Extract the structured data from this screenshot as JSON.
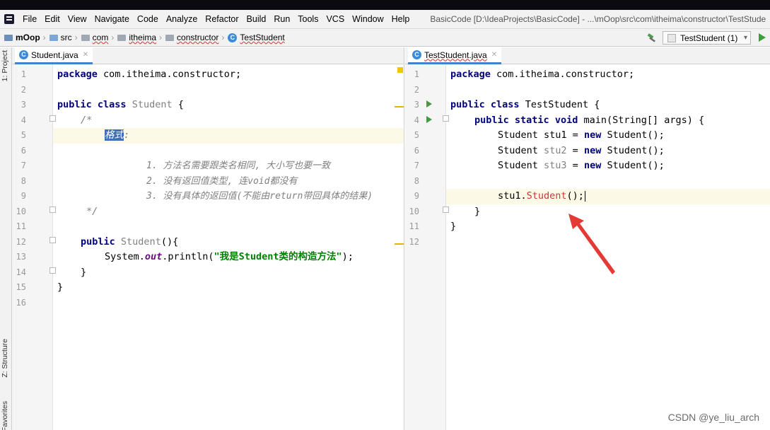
{
  "menubar": {
    "items": [
      "File",
      "Edit",
      "View",
      "Navigate",
      "Code",
      "Analyze",
      "Refactor",
      "Build",
      "Run",
      "Tools",
      "VCS",
      "Window",
      "Help"
    ],
    "title": "BasicCode [D:\\IdeaProjects\\BasicCode] - ...\\mOop\\src\\com\\itheima\\constructor\\TestStude"
  },
  "breadcrumb": {
    "items": [
      "mOop",
      "src",
      "com",
      "itheima",
      "constructor",
      "TestStudent"
    ]
  },
  "toolbar": {
    "run_config": "TestStudent (1)"
  },
  "sidebar": {
    "tabs": [
      "1: Project",
      "Z: Structure",
      "Favorites"
    ]
  },
  "left_editor": {
    "tab": "Student.java",
    "line_numbers": [
      "1",
      "2",
      "3",
      "4",
      "5",
      "6",
      "7",
      "8",
      "9",
      "10",
      "11",
      "12",
      "13",
      "14",
      "15",
      "16"
    ],
    "lines": [
      "package com.itheima.constructor;",
      "",
      "public class Student {",
      "    /*",
      "        格式:",
      "",
      "            1. 方法名需要跟类名相同, 大小写也要一致",
      "            2. 没有返回值类型, 连void都没有",
      "            3. 没有具体的返回值(不能由return带回具体的结果)",
      "     */",
      "",
      "    public Student(){",
      "        System.out.println(\"我是Student类的构造方法\");",
      "    }",
      "}",
      ""
    ],
    "tokens": {
      "package_kw": "package",
      "package_name": " com.itheima.constructor;",
      "public": "public",
      "class": "class",
      "class_name": "Student",
      "brace_open": " {",
      "comment_open": "/*",
      "format_label": "格式",
      "colon": ":",
      "rule1": "1. 方法名需要跟类名相同, 大小写也要一致",
      "rule2": "2. 没有返回值类型, 连void都没有",
      "rule3": "3. 没有具体的返回值(不能由return带回具体的结果)",
      "comment_close": "*/",
      "ctor_name": "Student",
      "ctor_sig": "(){",
      "system": "System.",
      "out": "out",
      "println": ".println(",
      "string": "\"我是Student类的构造方法\"",
      "stmt_end": ");",
      "close_brace": "}"
    }
  },
  "right_editor": {
    "tab": "TestStudent.java",
    "line_numbers": [
      "1",
      "2",
      "3",
      "4",
      "5",
      "6",
      "7",
      "8",
      "9",
      "10",
      "11",
      "12"
    ],
    "tokens": {
      "package_kw": "package",
      "package_name": " com.itheima.constructor;",
      "public": "public",
      "class": "class",
      "class_name": " TestStudent {",
      "static": "static",
      "void": "void",
      "main_sig": " main(String[] args) {",
      "student_type": "Student ",
      "stu1": "stu1",
      "stu2": "stu2",
      "stu3": "stu3",
      "assign": " = ",
      "new": "new",
      "ctor_call": " Student();",
      "stu1_dot": "stu1.",
      "ctor_red": "Student",
      "call_end": "();",
      "close_brace": "}"
    }
  },
  "watermark": "CSDN @ye_liu_arch",
  "colors": {
    "keyword": "#000080",
    "string": "#008000",
    "comment": "#808080",
    "selection": "#3f6fb5",
    "current_line": "#fcfae6",
    "arrow": "#e53935"
  }
}
